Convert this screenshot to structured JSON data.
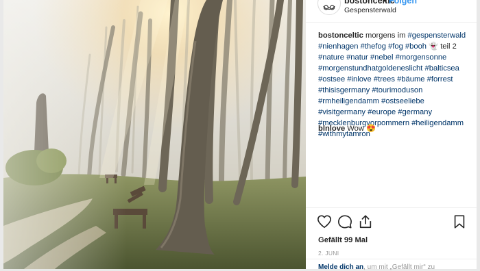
{
  "post": {
    "username": "bostonceltic",
    "separator": "•",
    "follow_label": "Folgen",
    "location": "Gespensterwald",
    "caption": {
      "username": "bostonceltic",
      "text_before_tags": " morgens im ",
      "tags_line": [
        "#gespensterwald",
        "#nienhagen",
        "#thefog",
        "#fog",
        "#booh",
        "👻",
        "teil 2",
        "#nature",
        "#natur",
        "#nebel",
        "#morgensonne",
        "#morgenstundhatgoldeneslicht",
        "#balticsea",
        "#ostsee",
        "#inlove",
        "#trees",
        "#bäume",
        "#forrest",
        "#thisisgermany",
        "#tourimoduson",
        "#rmheiligendamm",
        "#ostseeliebe",
        "#visitgermany",
        "#europe",
        "#germany",
        "#mecklenburgvorpommern",
        "#heiligendamm",
        "#withmytamron"
      ]
    },
    "comment": {
      "username": "blnlove",
      "text": "Wow 😍"
    },
    "likes": "Gefällt 99 Mal",
    "date": "2. JUNI",
    "login_prompt": {
      "link": "Melde dich an",
      "text": ", um mit „Gefällt mir“ zu"
    }
  },
  "icons": {
    "like": "heart-icon",
    "comment": "comment-icon",
    "share": "share-icon",
    "save": "bookmark-icon"
  }
}
